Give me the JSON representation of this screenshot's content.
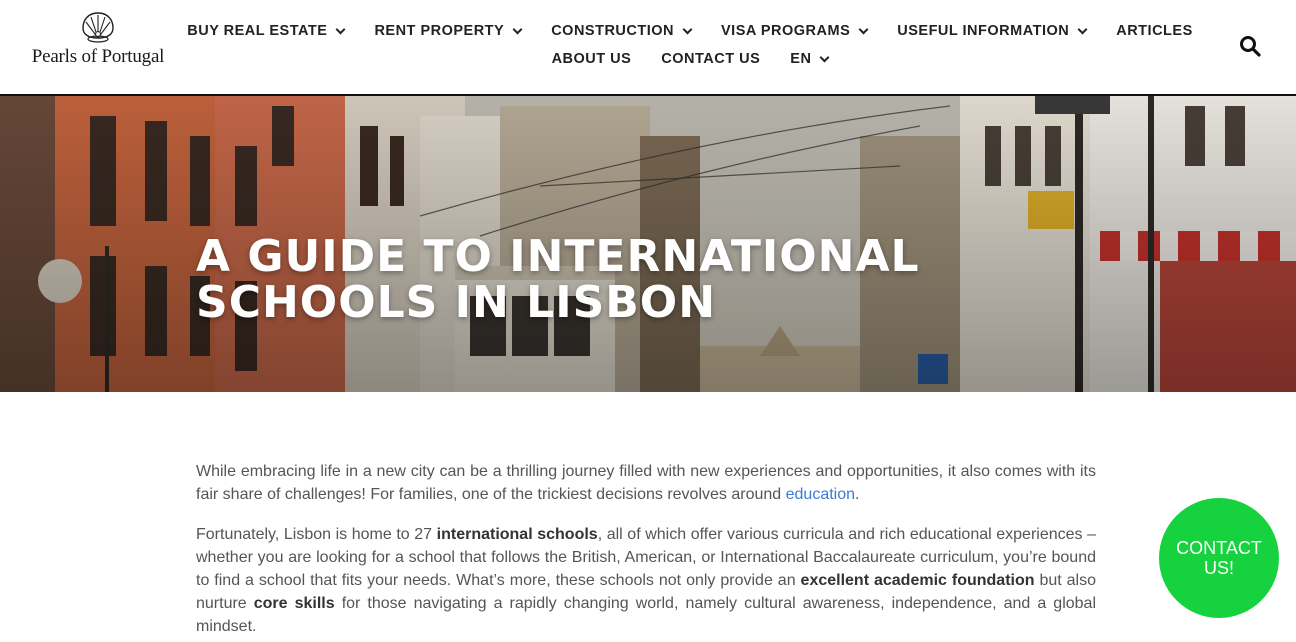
{
  "logo": {
    "text": "Pearls of Portugal"
  },
  "nav": {
    "row1": [
      {
        "label": "BUY REAL ESTATE",
        "dropdown": true
      },
      {
        "label": "RENT PROPERTY",
        "dropdown": true
      },
      {
        "label": "CONSTRUCTION",
        "dropdown": true
      },
      {
        "label": "VISA PROGRAMS",
        "dropdown": true
      },
      {
        "label": "USEFUL INFORMATION",
        "dropdown": true
      },
      {
        "label": "ARTICLES",
        "dropdown": false
      }
    ],
    "row2": [
      {
        "label": "ABOUT US",
        "dropdown": false
      },
      {
        "label": "CONTACT US",
        "dropdown": false
      },
      {
        "label": "EN",
        "dropdown": true
      }
    ]
  },
  "search": {
    "icon": "search-icon"
  },
  "hero": {
    "title_line1": "A GUIDE TO INTERNATIONAL",
    "title_line2": "SCHOOLS IN LISBON"
  },
  "article": {
    "p1_text": "While embracing life in a new city can be a thrilling journey filled with new experiences and opportunities, it also comes with its fair share of challenges! For families, one of the trickiest decisions revolves around ",
    "p1_link": "education",
    "p1_end": ".",
    "p2_a": "Fortunately, Lisbon is home to 27 ",
    "p2_b1": "international schools",
    "p2_c": ", all of which offer various curricula and rich educational experiences – whether you are looking for a school that follows the British, American, or International Baccalaureate curriculum, you’re bound to find a school that fits your needs. What’s more, these schools not only provide an ",
    "p2_b2": "excellent academic foundation",
    "p2_d": " but also nurture ",
    "p2_b3": "core skills",
    "p2_e": " for those navigating a rapidly changing world, namely cultural awareness, independence, and a global mindset."
  },
  "contact_bubble": {
    "line1": "CONTACT",
    "line2": "US!"
  },
  "colors": {
    "accent_green": "#15d23e",
    "link_blue": "#3a7bd5"
  }
}
